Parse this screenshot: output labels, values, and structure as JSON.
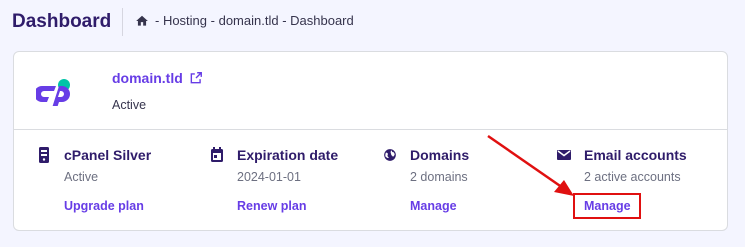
{
  "header": {
    "title": "Dashboard",
    "breadcrumb": [
      "- Hosting",
      " - domain.tld",
      " - Dashboard"
    ]
  },
  "site": {
    "domain": "domain.tld",
    "status": "Active",
    "logo_icon": "cpanel-logo"
  },
  "columns": [
    {
      "icon": "server-icon",
      "title": "cPanel Silver",
      "sub": "Active",
      "link": "Upgrade plan"
    },
    {
      "icon": "calendar-icon",
      "title": "Expiration date",
      "sub": "2024-01-01",
      "link": "Renew plan"
    },
    {
      "icon": "globe-icon",
      "title": "Domains",
      "sub": "2 domains",
      "link": "Manage"
    },
    {
      "icon": "email-icon",
      "title": "Email accounts",
      "sub": "2 active accounts",
      "link": "Manage"
    }
  ],
  "colors": {
    "accent": "#673de6",
    "title": "#2f1c6a",
    "annotation": "#e01010"
  }
}
